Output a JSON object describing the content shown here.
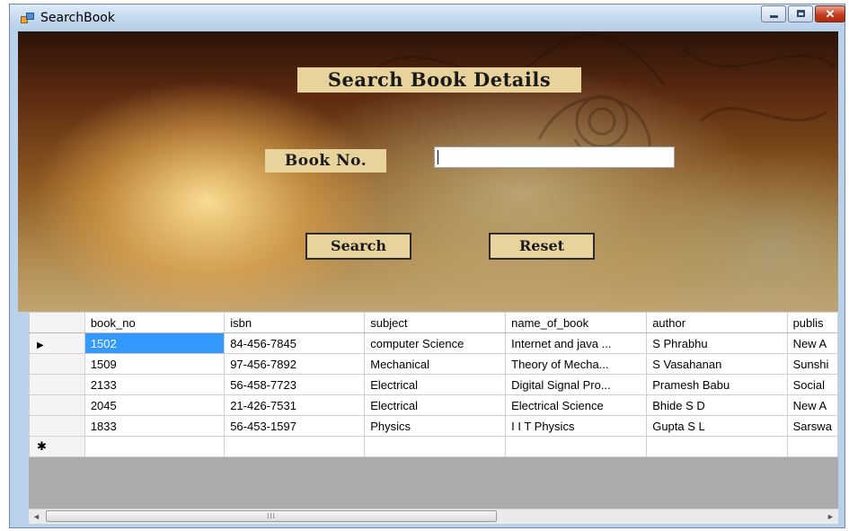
{
  "window": {
    "title": "SearchBook",
    "icon": "form-icon",
    "controls": {
      "minimize": "minimize-icon",
      "maximize": "maximize-icon",
      "close": "close-icon",
      "close_glyph": "✕"
    }
  },
  "form": {
    "heading": "Search Book Details",
    "book_no_label": "Book No.",
    "book_no_value": "",
    "search_label": "Search",
    "reset_label": "Reset"
  },
  "grid": {
    "columns": [
      "book_no",
      "isbn",
      "subject",
      "name_of_book",
      "author",
      "publis"
    ],
    "rows": [
      {
        "marker": "▶",
        "cells": [
          "1502",
          "84-456-7845",
          "computer Science",
          "Internet and java ...",
          "S Phrabhu",
          "New A"
        ]
      },
      {
        "marker": "",
        "cells": [
          "1509",
          "97-456-7892",
          "Mechanical",
          "Theory of Mecha...",
          "S Vasahanan",
          "Sunshi"
        ]
      },
      {
        "marker": "",
        "cells": [
          "2133",
          "56-458-7723",
          "Electrical",
          "Digital Signal Pro...",
          "Pramesh Babu",
          "Social"
        ]
      },
      {
        "marker": "",
        "cells": [
          "2045",
          "21-426-7531",
          "Electrical",
          "Electrical Science",
          "Bhide S D",
          "New A"
        ]
      },
      {
        "marker": "",
        "cells": [
          "1833",
          "56-453-1597",
          "Physics",
          "I I T Physics",
          "Gupta S L",
          "Sarswa"
        ]
      }
    ],
    "new_row_marker": "✱",
    "selected_cell": "1502"
  },
  "scrollbar": {
    "left_arrow": "◄",
    "right_arrow": "►",
    "thumb_grip": "III"
  },
  "colors": {
    "label_bg": "#e8d39c",
    "selection": "#3399ff",
    "grid_empty": "#ababab"
  }
}
